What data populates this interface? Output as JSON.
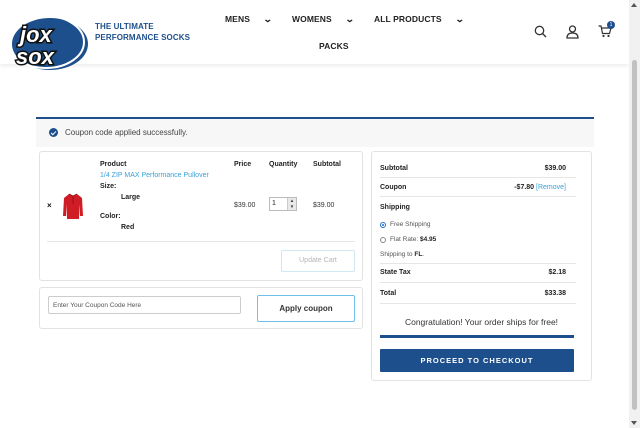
{
  "header": {
    "logo_text": [
      "jox",
      "sox"
    ],
    "tagline": [
      "THE ULTIMATE",
      "PERFORMANCE SOCKS"
    ],
    "nav": [
      {
        "label": "MENS",
        "has_dropdown": true
      },
      {
        "label": "WOMENS",
        "has_dropdown": true
      },
      {
        "label": "ALL PRODUCTS",
        "has_dropdown": true
      },
      {
        "label": "PACKS",
        "has_dropdown": false
      }
    ],
    "cart_count": "1",
    "icons": [
      "search-icon",
      "user-icon",
      "cart-icon",
      "chevron-down-icon"
    ]
  },
  "notice": {
    "text": "Coupon code applied successfully.",
    "icon": "check-circle-icon"
  },
  "cart": {
    "headers": {
      "product": "Product",
      "price": "Price",
      "quantity": "Quantity",
      "subtotal": "Subtotal"
    },
    "items": [
      {
        "remove": "×",
        "name": "1/4 ZIP MAX Performance Pullover",
        "size_label": "Size:",
        "size": "Large",
        "color_label": "Color:",
        "color": "Red",
        "price": "$39.00",
        "quantity": "1",
        "subtotal": "$39.00"
      }
    ],
    "update_button": "Update Cart"
  },
  "coupon": {
    "placeholder": "Enter Your Coupon Code Here",
    "apply_button": "Apply coupon"
  },
  "totals": {
    "subtotal_label": "Subtotal",
    "subtotal": "$39.00",
    "coupon_label": "Coupon",
    "coupon_value": "-$7.80",
    "coupon_remove": "[Remove]",
    "shipping_label": "Shipping",
    "shipping_options": [
      {
        "label": "Free Shipping",
        "price": "",
        "selected": true
      },
      {
        "label": "Flat Rate: ",
        "price": "$4.95",
        "selected": false
      }
    ],
    "shipping_to_label": "Shipping to ",
    "shipping_to": "FL",
    "tax_label": "State Tax",
    "tax": "$2.18",
    "total_label": "Total",
    "total": "$33.38",
    "free_ship_message": "Congratulation! Your order ships for free!",
    "free_ship_progress": 1.0,
    "checkout_button": "PROCEED TO CHECKOUT"
  },
  "colors": {
    "brand_blue": "#1d4f8c",
    "link_blue": "#3aa0d8",
    "product_red": "#d01c24"
  }
}
